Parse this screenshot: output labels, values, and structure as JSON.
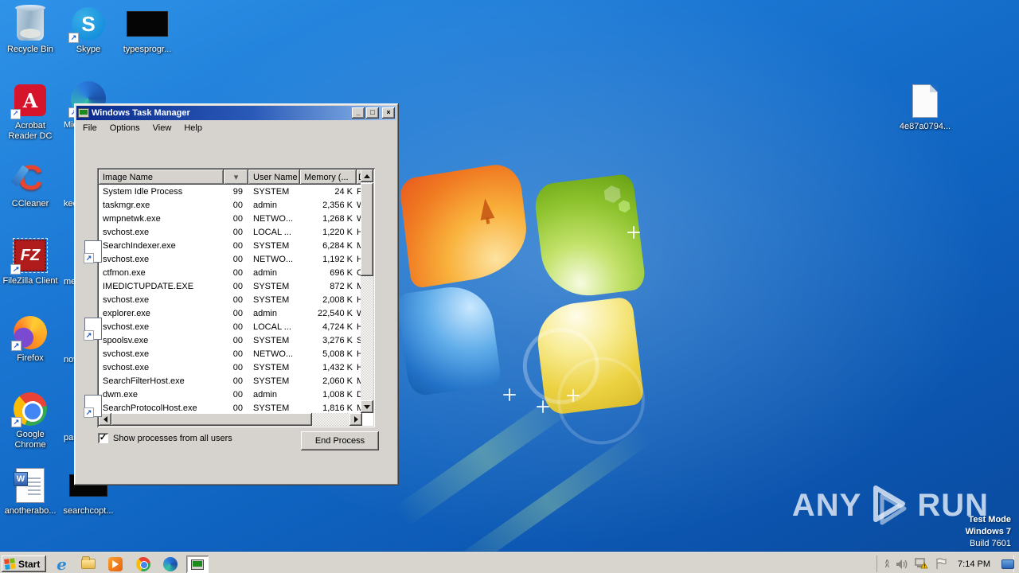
{
  "desktop": {
    "labels": {
      "recycle_bin": "Recycle Bin",
      "skype": "Skype",
      "typesprogr": "typesprogr...",
      "acrobat": "Acrobat Reader DC",
      "edge_partial": "Micr",
      "ccleaner": "CCleaner",
      "kee": "kee",
      "filezilla": "FileZilla Client",
      "me": "me",
      "firefox": "Firefox",
      "nov": "nov",
      "chrome": "Google Chrome",
      "pas": "pas",
      "anotherabo": "anotherabo...",
      "searchcopt": "searchcopt...",
      "hashfile": "4e87a0794..."
    }
  },
  "taskmanager": {
    "title": "Windows Task Manager",
    "window_buttons": {
      "minimize": "_",
      "maximize": "□",
      "close": "×"
    },
    "menus": [
      {
        "label": "File"
      },
      {
        "label": "Options"
      },
      {
        "label": "View"
      },
      {
        "label": "Help"
      }
    ],
    "columns": {
      "image_name": "Image Name",
      "cpu_sort": "▾",
      "user_name": "User Name",
      "memory": "Memory (...",
      "description": "D"
    },
    "processes": [
      {
        "name": "System Idle Process",
        "cpu": "99",
        "user": "SYSTEM",
        "memory": "24 K",
        "desc": "Pe"
      },
      {
        "name": "taskmgr.exe",
        "cpu": "00",
        "user": "admin",
        "memory": "2,356 K",
        "desc": "W"
      },
      {
        "name": "wmpnetwk.exe",
        "cpu": "00",
        "user": "NETWO...",
        "memory": "1,268 K",
        "desc": "W"
      },
      {
        "name": "svchost.exe",
        "cpu": "00",
        "user": "LOCAL ...",
        "memory": "1,220 K",
        "desc": "H"
      },
      {
        "name": "SearchIndexer.exe",
        "cpu": "00",
        "user": "SYSTEM",
        "memory": "6,284 K",
        "desc": "M"
      },
      {
        "name": "svchost.exe",
        "cpu": "00",
        "user": "NETWO...",
        "memory": "1,192 K",
        "desc": "H"
      },
      {
        "name": "ctfmon.exe",
        "cpu": "00",
        "user": "admin",
        "memory": "696 K",
        "desc": "C"
      },
      {
        "name": "IMEDICTUPDATE.EXE",
        "cpu": "00",
        "user": "SYSTEM",
        "memory": "872 K",
        "desc": "M"
      },
      {
        "name": "svchost.exe",
        "cpu": "00",
        "user": "SYSTEM",
        "memory": "2,008 K",
        "desc": "H"
      },
      {
        "name": "explorer.exe",
        "cpu": "00",
        "user": "admin",
        "memory": "22,540 K",
        "desc": "W"
      },
      {
        "name": "svchost.exe",
        "cpu": "00",
        "user": "LOCAL ...",
        "memory": "4,724 K",
        "desc": "H"
      },
      {
        "name": "spoolsv.exe",
        "cpu": "00",
        "user": "SYSTEM",
        "memory": "3,276 K",
        "desc": "Sp"
      },
      {
        "name": "svchost.exe",
        "cpu": "00",
        "user": "NETWO...",
        "memory": "5,008 K",
        "desc": "H"
      },
      {
        "name": "svchost.exe",
        "cpu": "00",
        "user": "SYSTEM",
        "memory": "1,432 K",
        "desc": "H"
      },
      {
        "name": "SearchFilterHost.exe",
        "cpu": "00",
        "user": "SYSTEM",
        "memory": "2,060 K",
        "desc": "M"
      },
      {
        "name": "dwm.exe",
        "cpu": "00",
        "user": "admin",
        "memory": "1,008 K",
        "desc": "D"
      },
      {
        "name": "SearchProtocolHost.exe",
        "cpu": "00",
        "user": "SYSTEM",
        "memory": "1,816 K",
        "desc": "M"
      }
    ],
    "footer": {
      "show_all_users_label": "Show processes from all users",
      "show_all_users_checked": "✓",
      "end_process_label": "End Process"
    }
  },
  "watermark": {
    "brand_left": "ANY",
    "brand_right": "RUN",
    "line1": "Test Mode",
    "line2": "Windows 7",
    "line3": "Build 7601"
  },
  "taskbar": {
    "start_label": "Start",
    "clock": "7:14 PM"
  },
  "colors": {
    "titlebar_left": "#0a2a8c",
    "titlebar_right": "#a8c8f0",
    "classic_gray": "#d6d3ce",
    "desktop_blue": "#1470cc",
    "selection_white": "#ffffff"
  }
}
